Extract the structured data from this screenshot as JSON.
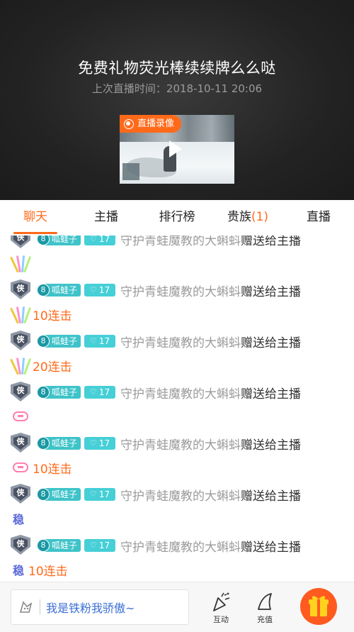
{
  "header": {
    "title": "免费礼物荧光棒续续牌么么哒",
    "last_live": "上次直播时间：2018-10-11 20:06",
    "replay_badge": "直播录像"
  },
  "tabs": [
    {
      "label": "聊天",
      "active": true
    },
    {
      "label": "主播"
    },
    {
      "label": "排行榜"
    },
    {
      "label": "贵族",
      "count": "(1)"
    },
    {
      "label": "直播"
    }
  ],
  "messages": [
    {
      "shield": "侠",
      "fan_level": "8",
      "fan_name": "呱蛙子",
      "guard": "17",
      "user": "守护青蛙魔教的大蝌蚪",
      "action": "赠送给主播",
      "gift": "glowstick",
      "combo": ""
    },
    {
      "shield": "侠",
      "fan_level": "8",
      "fan_name": "呱蛙子",
      "guard": "17",
      "user": "守护青蛙魔教的大蝌蚪",
      "action": "赠送给主播",
      "gift": "glowstick",
      "combo": "10连击"
    },
    {
      "shield": "侠",
      "fan_level": "8",
      "fan_name": "呱蛙子",
      "guard": "17",
      "user": "守护青蛙魔教的大蝌蚪",
      "action": "赠送给主播",
      "gift": "glowstick",
      "combo": "20连击"
    },
    {
      "shield": "侠",
      "fan_level": "8",
      "fan_name": "呱蛙子",
      "guard": "17",
      "user": "守护青蛙魔教的大蝌蚪",
      "action": "赠送给主播",
      "gift": "bubble",
      "combo": ""
    },
    {
      "shield": "侠",
      "fan_level": "8",
      "fan_name": "呱蛙子",
      "guard": "17",
      "user": "守护青蛙魔教的大蝌蚪",
      "action": "赠送给主播",
      "gift": "bubble",
      "combo": "10连击"
    },
    {
      "shield": "侠",
      "fan_level": "8",
      "fan_name": "呱蛙子",
      "guard": "17",
      "user": "守护青蛙魔教的大蝌蚪",
      "action": "赠送给主播",
      "gift": "word",
      "gift_text": "稳",
      "combo": ""
    },
    {
      "shield": "侠",
      "fan_level": "8",
      "fan_name": "呱蛙子",
      "guard": "17",
      "user": "守护青蛙魔教的大蝌蚪",
      "action": "赠送给主播",
      "gift": "word",
      "gift_text": "稳",
      "combo": "10连击"
    }
  ],
  "bottom": {
    "input_placeholder": "我是铁粉我骄傲~",
    "interact_label": "互动",
    "recharge_label": "充值"
  },
  "colors": {
    "accent": "#ff6a1a",
    "fan_badge": "#3ec3c9",
    "link": "#3b6fd4"
  }
}
